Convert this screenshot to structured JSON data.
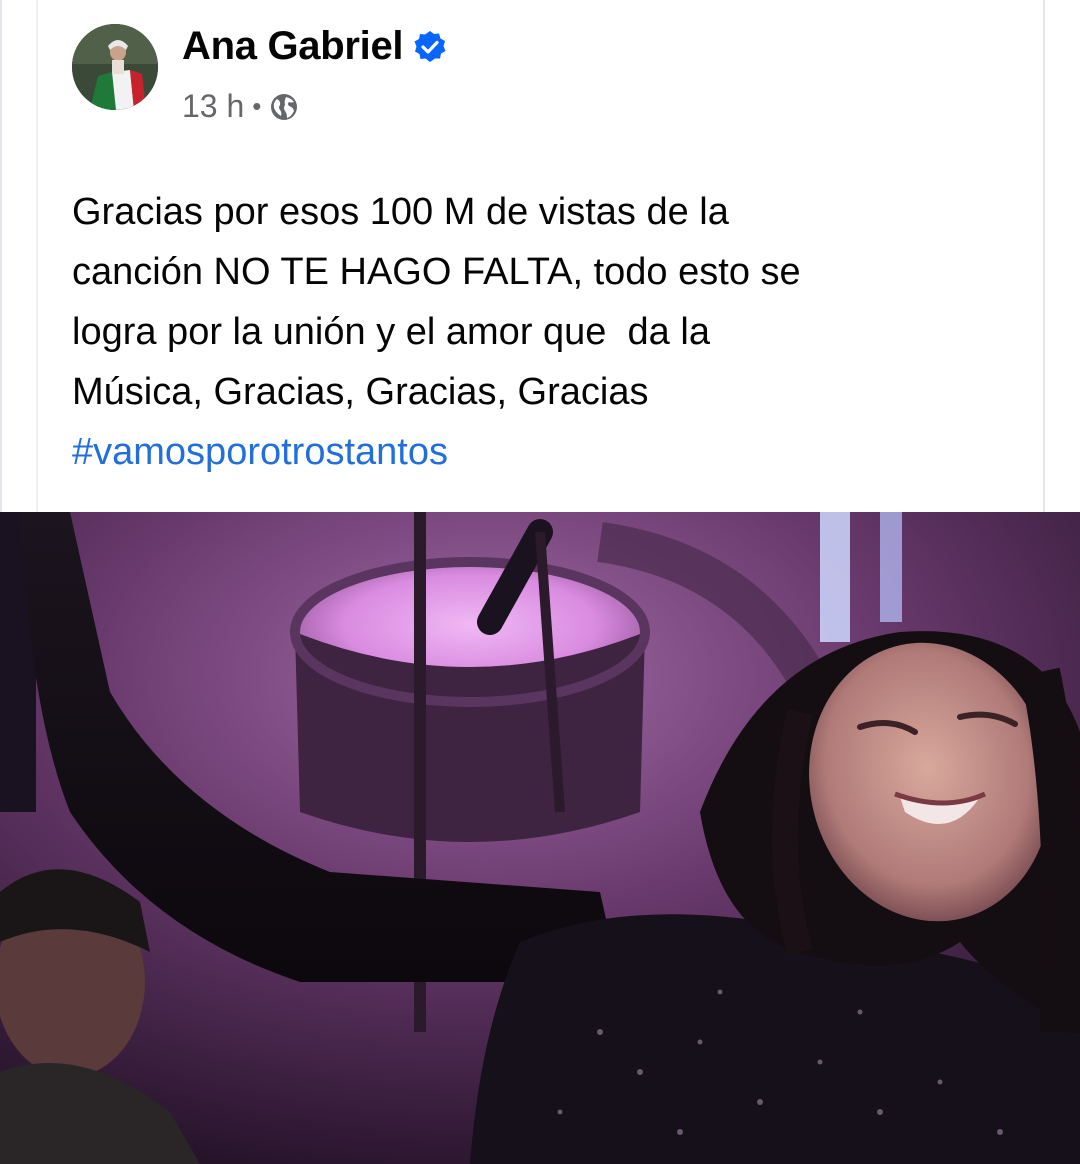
{
  "post": {
    "author": "Ana Gabriel",
    "verified_icon": "verified-badge-icon",
    "timestamp": "13 h",
    "separator": "•",
    "audience_icon": "globe-icon",
    "text_lines": [
      "Gracias por esos 100 M de vistas de la",
      "canción NO TE HAGO FALTA, todo esto se",
      "logra por la unión y el amor que  da la",
      "Música, Gracias, Gracias, Gracias"
    ],
    "hashtag": "#vamosporotrostantos",
    "colors": {
      "text": "#050505",
      "meta": "#65676b",
      "link": "#216fdb",
      "verified": "#0866ff"
    }
  }
}
